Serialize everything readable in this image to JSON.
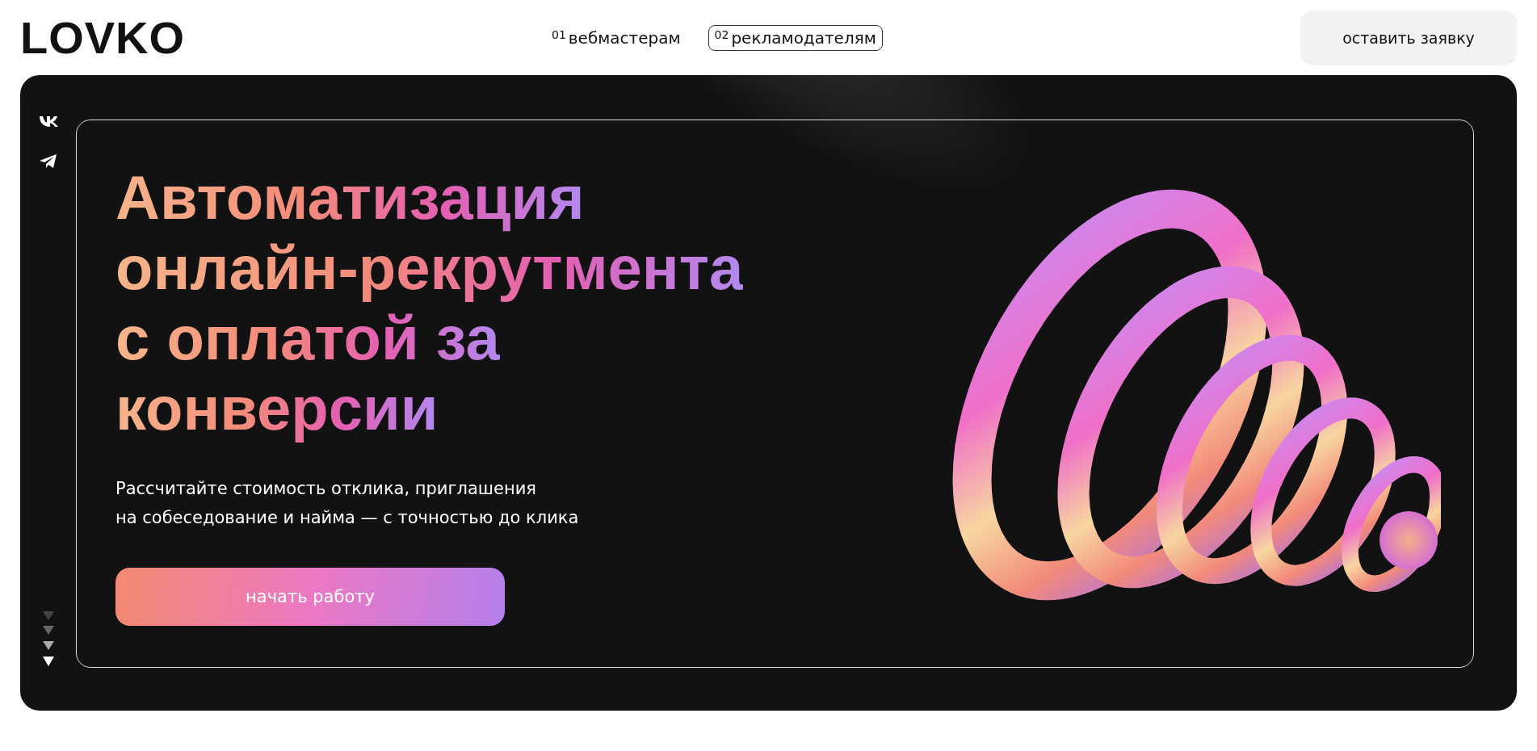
{
  "header": {
    "logo": "LOVKO",
    "nav": [
      {
        "number": "01",
        "label": "вебмастерам",
        "selected": false
      },
      {
        "number": "02",
        "label": "рекламодателям",
        "selected": true
      }
    ],
    "cta": "оставить заявку"
  },
  "hero": {
    "headline": [
      "Автоматизация",
      "онлайн-рекрутмента",
      "с оплатой за",
      "конверсии"
    ],
    "subtitle": [
      "Рассчитайте стоимость отклика, приглашения",
      "на собеседование и найма — с точностью до клика"
    ],
    "button": "начать работу"
  }
}
